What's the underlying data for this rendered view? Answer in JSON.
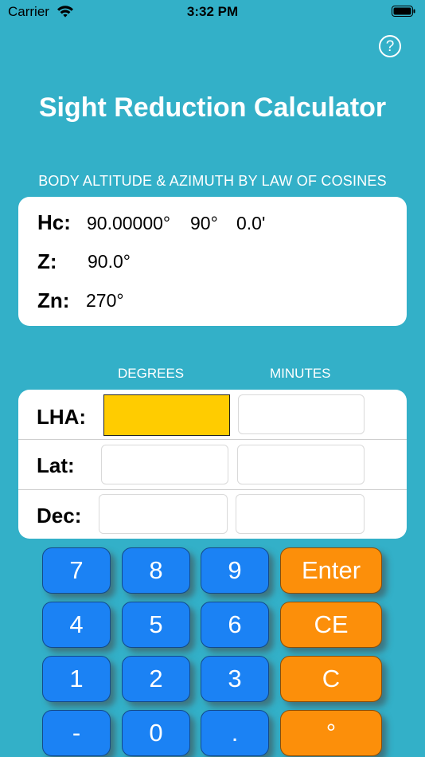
{
  "status_bar": {
    "carrier": "Carrier",
    "time": "3:32 PM"
  },
  "header": {
    "help_label": "?",
    "title": "Sight Reduction Calculator"
  },
  "results": {
    "subtitle": "BODY ALTITUDE & AZIMUTH BY LAW OF COSINES",
    "hc_label": "Hc:",
    "hc_decimal": "90.00000°",
    "hc_degrees": "90°",
    "hc_minutes": "0.0'",
    "z_label": "Z:",
    "z_value": "90.0°",
    "zn_label": "Zn:",
    "zn_value": "270°"
  },
  "inputs": {
    "degrees_header": "DEGREES",
    "minutes_header": "MINUTES",
    "lha_label": "LHA:",
    "lat_label": "Lat:",
    "dec_label": "Dec:",
    "active_field": "lha-degrees"
  },
  "keypad": {
    "k7": "7",
    "k8": "8",
    "k9": "9",
    "enter": "Enter",
    "k4": "4",
    "k5": "5",
    "k6": "6",
    "ce": "CE",
    "k1": "1",
    "k2": "2",
    "k3": "3",
    "clear": "C",
    "minus": "-",
    "k0": "0",
    "dot": ".",
    "degree": "°"
  },
  "colors": {
    "background": "#33b0c8",
    "number_key": "#1b82f4",
    "action_key": "#fc8f0a",
    "active_field": "#ffcc00"
  }
}
